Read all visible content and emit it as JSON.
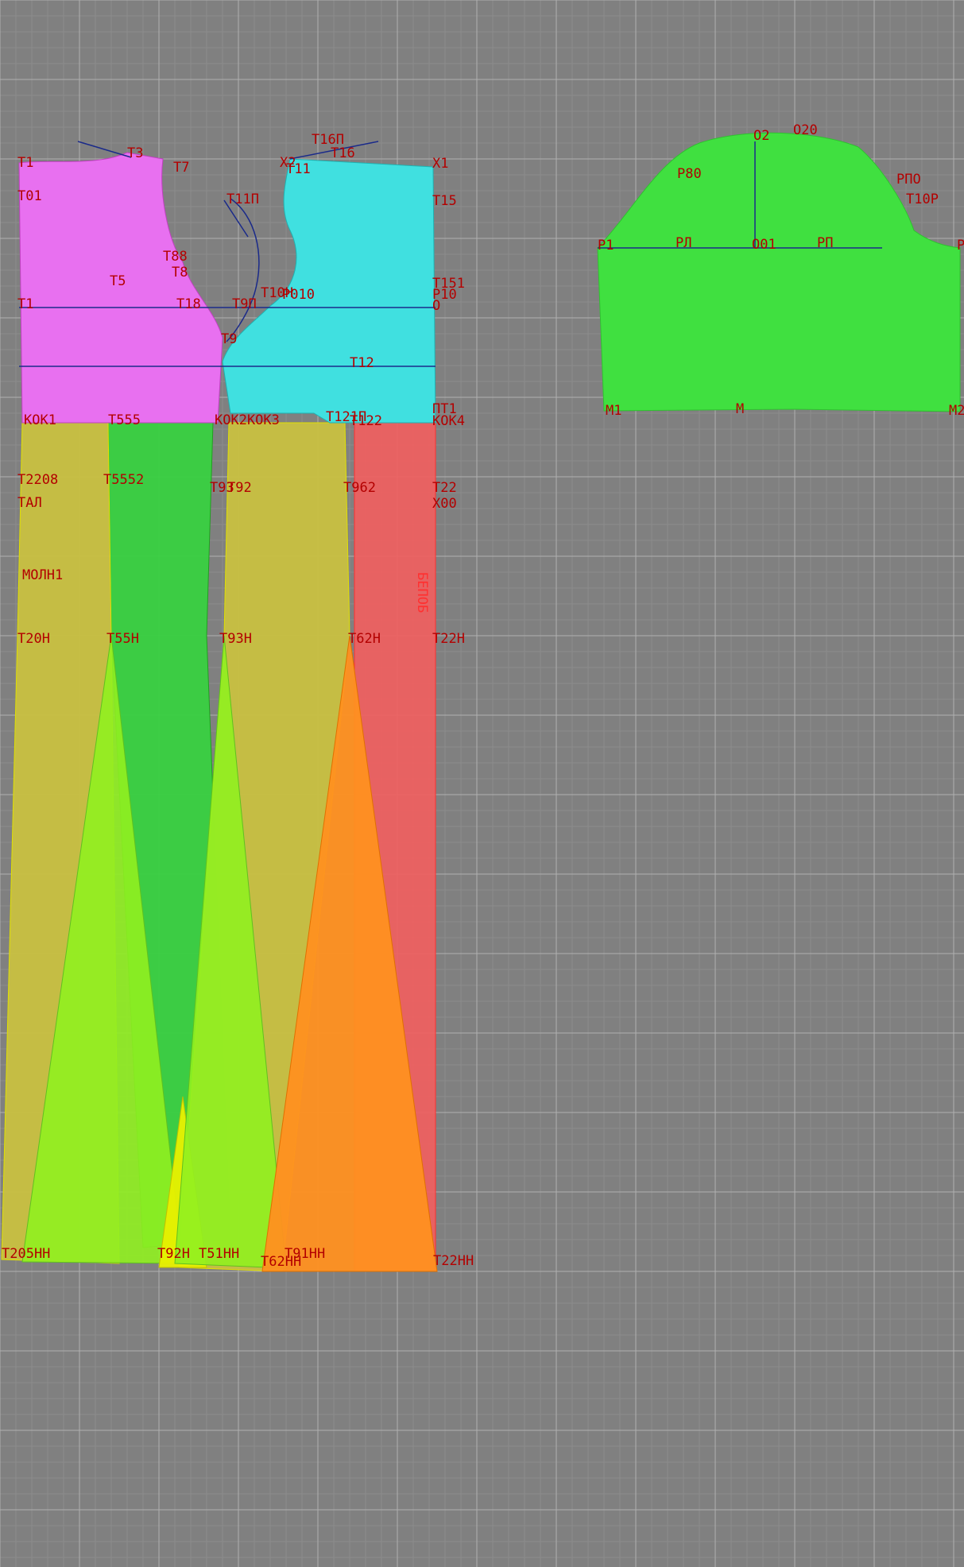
{
  "colors": {
    "background": "#808080",
    "grid_line": "#a8a8a8",
    "label": "#b30000",
    "construction_line": "#1a2a8a",
    "point_marker": "#c000c0",
    "piece_bodice_back": "#e870f0",
    "piece_bodice_front": "#40e0e0",
    "piece_sleeve": "#40e040",
    "piece_skirt_yellow": "#c8c040",
    "piece_skirt_green": "#38d040",
    "piece_skirt_red": "#f06060",
    "piece_gore_lime": "#90f020",
    "piece_gore_yellow": "#e8f000",
    "piece_gore_orange": "#ff9020"
  },
  "pieces": [
    {
      "name": "bodice-back",
      "color_key": "piece_bodice_back"
    },
    {
      "name": "bodice-front",
      "color_key": "piece_bodice_front"
    },
    {
      "name": "sleeve",
      "color_key": "piece_sleeve"
    },
    {
      "name": "skirt-panel-left",
      "color_key": "piece_skirt_yellow"
    },
    {
      "name": "skirt-panel-green",
      "color_key": "piece_skirt_green"
    },
    {
      "name": "skirt-panel-center",
      "color_key": "piece_skirt_yellow"
    },
    {
      "name": "skirt-panel-red",
      "color_key": "piece_skirt_red"
    },
    {
      "name": "gore-lime-1",
      "color_key": "piece_gore_lime"
    },
    {
      "name": "gore-lime-2",
      "color_key": "piece_gore_lime"
    },
    {
      "name": "gore-yellow",
      "color_key": "piece_gore_yellow"
    },
    {
      "name": "gore-orange",
      "color_key": "piece_gore_orange"
    }
  ],
  "labels": {
    "t1": "T1",
    "t3": "T3",
    "t7": "T7",
    "x2": "X2",
    "t11": "T11",
    "t16p": "T16П",
    "t16": "T16",
    "x1": "X1",
    "t01": "T01",
    "t11p": "T11П",
    "t15": "T15",
    "t88": "T88",
    "t8": "T8",
    "t5": "T5",
    "t151": "T151",
    "t10n": "T10H",
    "p010": "P010",
    "p10": "P10",
    "t1_waist": "T1",
    "t18": "T18",
    "t9p": "T9П",
    "o": "O",
    "t9": "T9",
    "t12": "T12",
    "kok1": "KOK1",
    "t555": "T555",
    "kok2kok3": "KOK2KOK3",
    "t121p": "T121П",
    "t122": "T122",
    "pt1": "ПT1",
    "kok4": "KOK4",
    "t2208": "T2208",
    "t5552": "T5552",
    "t93": "T93",
    "t92": "T92",
    "t962": "T962",
    "t22": "T22",
    "tal": "TAЛ",
    "x00": "X00",
    "molni": "MOЛH1",
    "t20n": "T20H",
    "t55n": "T55H",
    "t93n": "T93H",
    "t62n": "T62H",
    "t22n": "T22H",
    "vertical_label": "БЕПОБ",
    "t205hn": "T205HH",
    "t92n": "T92H",
    "t51nn": "T51HH",
    "t62nn": "T62HH",
    "t91nn": "T91HH",
    "t22nn": "T22HH",
    "o2": "O2",
    "o20": "O20",
    "p80": "P80",
    "rpo": "PПO",
    "t10r": "T10P",
    "r1": "P1",
    "rl": "PЛ",
    "o01": "O01",
    "rp": "PП",
    "r2": "P",
    "m1": "M1",
    "m": "M",
    "m2": "M2"
  }
}
